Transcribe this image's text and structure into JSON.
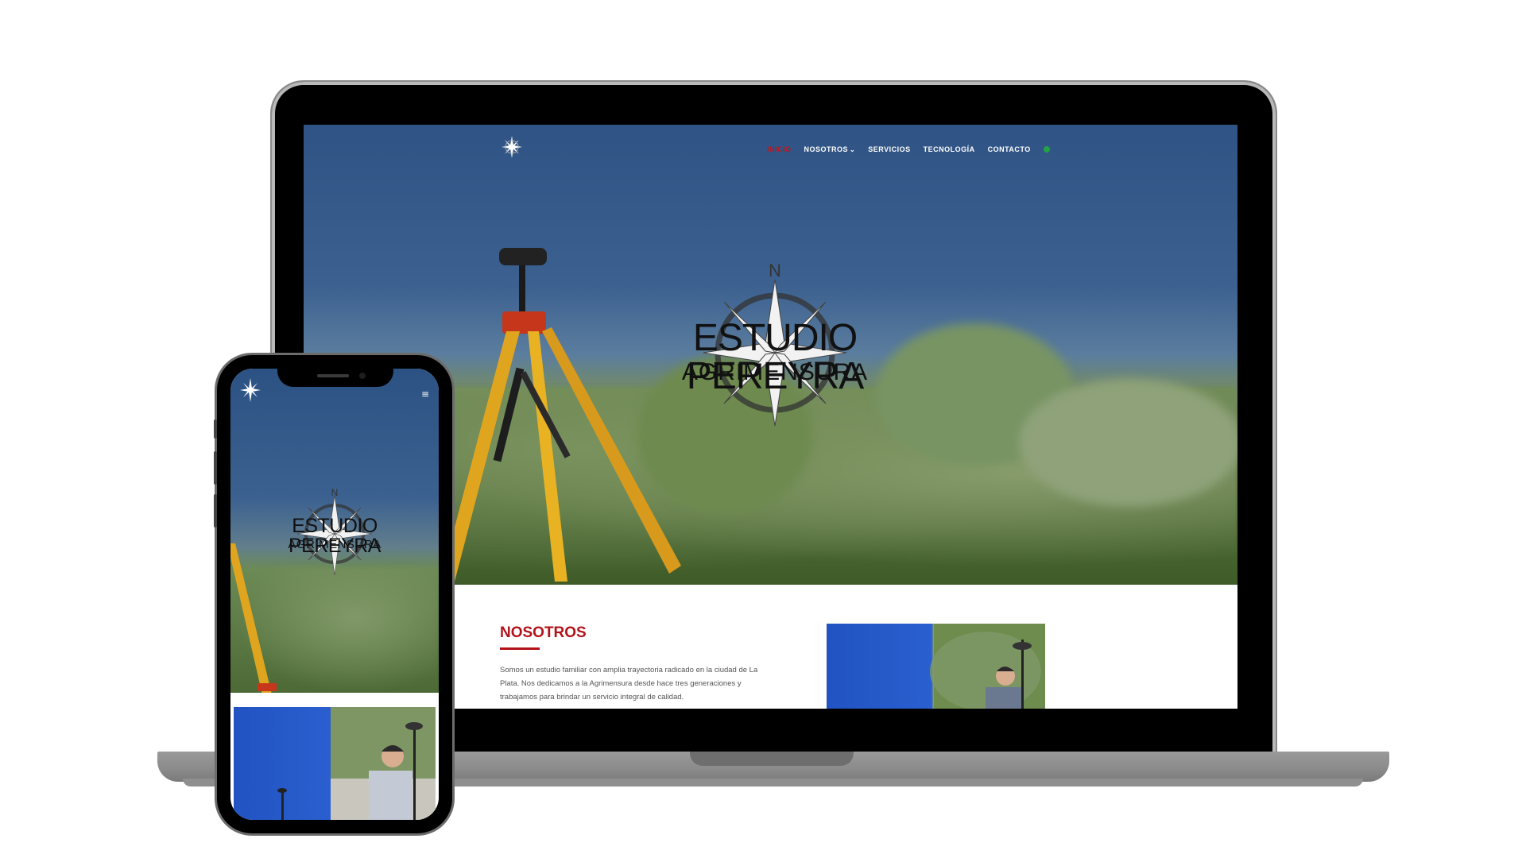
{
  "site": {
    "nav": {
      "items": [
        {
          "label": "INICIO",
          "active": true
        },
        {
          "label": "NOSOTROS",
          "dropdown": true
        },
        {
          "label": "SERVICIOS"
        },
        {
          "label": "TECNOLOGÍA"
        },
        {
          "label": "CONTACTO"
        }
      ],
      "chevron": "⌄"
    },
    "hero": {
      "compass_letter": "N",
      "title": "ESTUDIO PEREYRA",
      "subtitle": "AGRIMENSURA"
    },
    "nosotros": {
      "heading": "NOSOTROS",
      "text": "Somos un estudio familiar con amplia trayectoria radicado en la ciudad de La Plata. Nos dedicamos a la Agrimensura desde hace tres generaciones y trabajamos para brindar un servicio integral de calidad."
    }
  },
  "mobile": {
    "menu_icon": "≡",
    "hero": {
      "compass_letter": "N",
      "title": "ESTUDIO PEREYRA",
      "subtitle": "AGRIMENSURA"
    }
  },
  "colors": {
    "accent_red": "#b3121a",
    "whatsapp_green": "#25a244",
    "sky_blue": "#2f5384"
  },
  "icons": [
    "compass-rose-icon",
    "whatsapp-icon",
    "hamburger-menu-icon",
    "chevron-down-icon"
  ]
}
